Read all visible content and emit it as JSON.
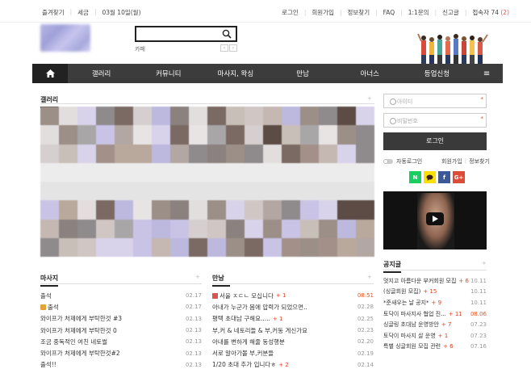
{
  "topbar": {
    "bookmark": "즐겨찾기",
    "tax": "세금",
    "date": "03월 10일(월)",
    "login": "로그인",
    "join": "회원가입",
    "find": "정보찾기",
    "faq": "FAQ",
    "qna": "1:1문의",
    "report": "신고글",
    "visitors_label": "접속자",
    "visitors_count": "74",
    "visitors_count_extra": "(2)"
  },
  "search": {
    "placeholder": "",
    "sub_label": "카페",
    "prev_arrow": "‹",
    "next_arrow": "›"
  },
  "nav": {
    "items": [
      "갤러리",
      "커뮤니티",
      "마사지, 왁싱",
      "만남",
      "아너스",
      "등업신청"
    ]
  },
  "gallery": {
    "title": "갤러리",
    "more": "+"
  },
  "massage": {
    "title": "마사지",
    "more": "+",
    "rows": [
      {
        "text": "출석",
        "date": "02.17",
        "cmt": "",
        "icon": ""
      },
      {
        "text": "출석",
        "date": "02.17",
        "cmt": "",
        "icon": "img"
      },
      {
        "text": "와이프가 처제에게 부탁한것 #3",
        "date": "02.13",
        "cmt": "",
        "icon": ""
      },
      {
        "text": "와이프가 처제에게 부탁한것 0",
        "date": "02.13",
        "cmt": "",
        "icon": ""
      },
      {
        "text": "조금 중독적인 여친 네토썰",
        "date": "02.13",
        "cmt": "",
        "icon": ""
      },
      {
        "text": "와이프가 처제에게 부탁한것#2",
        "date": "02.13",
        "cmt": "",
        "icon": ""
      },
      {
        "text": "출석!!",
        "date": "02.13",
        "cmt": "",
        "icon": ""
      }
    ]
  },
  "meeting": {
    "title": "만남",
    "more": "+",
    "rows": [
      {
        "text": "서울 ㅈㄷㄴ 모십니다",
        "date": "08:51",
        "cmt": "+ 1",
        "icon": "new",
        "red": true
      },
      {
        "text": "아내가 누군가 몸에 압력가 되었으면..",
        "date": "02.28",
        "cmt": "",
        "icon": "",
        "red": false
      },
      {
        "text": "평택 초대남 구해요.....",
        "date": "02.25",
        "cmt": "+ 1",
        "icon": "",
        "red": false
      },
      {
        "text": "부,커 & 네토리들 & 부,커동 게신가요",
        "date": "02.23",
        "cmt": "",
        "icon": "",
        "red": false
      },
      {
        "text": "아내를 변하게 해줄 동성행분",
        "date": "02.20",
        "cmt": "",
        "icon": "",
        "red": false
      },
      {
        "text": "서로 알아가볼 부,커분들",
        "date": "02.19",
        "cmt": "",
        "icon": "",
        "red": false
      },
      {
        "text": "1/20 초대 추가 입니다ㅎ",
        "date": "02.14",
        "cmt": "+ 2",
        "icon": "",
        "red": false
      }
    ]
  },
  "login": {
    "id_placeholder": "아이디",
    "pw_placeholder": "비밀번호",
    "required": "*",
    "button": "로그인",
    "auto": "자동로그인",
    "join": "회원가입",
    "find": "정보찾기",
    "social": [
      "N",
      "",
      "f",
      "G+"
    ]
  },
  "notice": {
    "title": "공지글",
    "more": "+",
    "rows": [
      {
        "text": "멋지고 아름다운 부커회원 모집",
        "cmt": "+ 6",
        "date": "10.11",
        "red": false
      },
      {
        "text": "(싱글회원 모집)",
        "cmt": "+ 15",
        "date": "10.11",
        "red": false
      },
      {
        "text": "*준새우는 날 공지*",
        "cmt": "+ 9",
        "date": "10.11",
        "red": false
      },
      {
        "text": "토닥이 마사지사 협업 진...",
        "cmt": "+ 11",
        "date": "08.06",
        "red": false
      },
      {
        "text": "싱글링 초대남 운영방안",
        "cmt": "+ 7",
        "date": "07.23",
        "red": false
      },
      {
        "text": "토닥이 마사지 살 운영",
        "cmt": "+ 1",
        "date": "07.23",
        "red": false
      },
      {
        "text": "특별 싱글회원 모집 관련",
        "cmt": "+ 6",
        "date": "07.16",
        "red": false
      }
    ]
  },
  "colors": {
    "nav_bg": "#3c3c3c",
    "accent_red": "#e2401f",
    "naver": "#19ce60",
    "kakao": "#f9e000",
    "facebook": "#3b5998",
    "google": "#dd4b39"
  }
}
